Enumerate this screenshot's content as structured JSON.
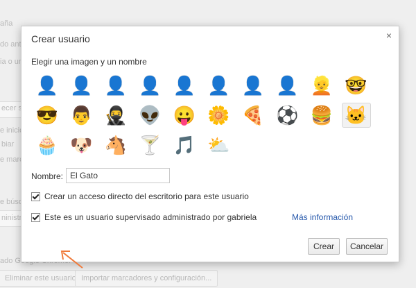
{
  "background": {
    "sidebar_fragments": [
      "aña",
      "do ant",
      "ia o un",
      "ecer se",
      "e inicio",
      "biar",
      "e marc",
      "e búsqu",
      "ninistra"
    ],
    "footer_fragment": "ado Google Chrome.",
    "remove_user_button": "Eliminar este usuario",
    "import_button": "Importar marcadores y configuración..."
  },
  "dialog": {
    "title": "Crear usuario",
    "close_glyph": "×",
    "subtitle": "Elegir una imagen y un nombre",
    "avatars": [
      {
        "name": "avatar-white-silhouette",
        "glyph": "👤",
        "color": "#ffffff"
      },
      {
        "name": "avatar-teal-silhouette",
        "glyph": "👤",
        "color": "#5fc9c4"
      },
      {
        "name": "avatar-blue-silhouette",
        "glyph": "👤",
        "color": "#2b9fe0"
      },
      {
        "name": "avatar-green-silhouette",
        "glyph": "👤",
        "color": "#57b73a"
      },
      {
        "name": "avatar-orange-silhouette",
        "glyph": "👤",
        "color": "#f7a23a"
      },
      {
        "name": "avatar-purple-silhouette",
        "glyph": "👤",
        "color": "#a27ee0"
      },
      {
        "name": "avatar-red-silhouette",
        "glyph": "👤",
        "color": "#ec5a5a"
      },
      {
        "name": "avatar-yellow-silhouette",
        "glyph": "👤",
        "color": "#f2c21c"
      },
      {
        "name": "avatar-blonde-woman",
        "glyph": "👱",
        "color": ""
      },
      {
        "name": "avatar-man-with-glasses",
        "glyph": "🤓",
        "color": ""
      },
      {
        "name": "avatar-woman-sunglasses",
        "glyph": "😎",
        "color": ""
      },
      {
        "name": "avatar-man",
        "glyph": "👨",
        "color": ""
      },
      {
        "name": "avatar-ninja",
        "glyph": "🥷",
        "color": ""
      },
      {
        "name": "avatar-alien",
        "glyph": "👽",
        "color": ""
      },
      {
        "name": "avatar-smiley",
        "glyph": "😛",
        "color": ""
      },
      {
        "name": "avatar-flower",
        "glyph": "🌼",
        "color": ""
      },
      {
        "name": "avatar-pizza",
        "glyph": "🍕",
        "color": ""
      },
      {
        "name": "avatar-soccer-ball",
        "glyph": "⚽",
        "color": ""
      },
      {
        "name": "avatar-hamburger",
        "glyph": "🍔",
        "color": ""
      },
      {
        "name": "avatar-cat",
        "glyph": "🐱",
        "color": ""
      },
      {
        "name": "avatar-cupcake",
        "glyph": "🧁",
        "color": ""
      },
      {
        "name": "avatar-dog",
        "glyph": "🐶",
        "color": ""
      },
      {
        "name": "avatar-horse",
        "glyph": "🐴",
        "color": ""
      },
      {
        "name": "avatar-cocktail",
        "glyph": "🍸",
        "color": ""
      },
      {
        "name": "avatar-music-note",
        "glyph": "🎵",
        "color": ""
      },
      {
        "name": "avatar-sun-cloud",
        "glyph": "⛅",
        "color": ""
      }
    ],
    "selected_avatar": "avatar-cat",
    "name_label": "Nombre:",
    "name_value": "El Gato",
    "shortcut_checkbox": {
      "label": "Crear un acceso directo del escritorio para este usuario",
      "checked": true
    },
    "supervised_checkbox": {
      "label": "Este es un usuario supervisado administrado por gabriela",
      "checked": true
    },
    "more_info_link": "Más información",
    "create_button": "Crear",
    "cancel_button": "Cancelar",
    "accent_color": "#f07a3a",
    "link_color": "#2255aa"
  }
}
